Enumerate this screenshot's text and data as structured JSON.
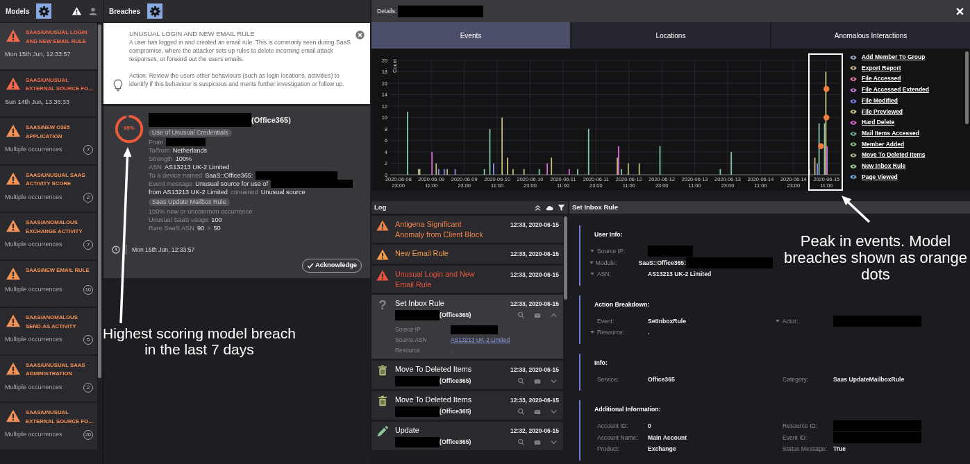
{
  "models_panel": {
    "title": "Models",
    "items": [
      {
        "title": "SAAS/UNUSUAL LOGIN AND NEW EMAIL RULE",
        "time": "Mon 15th Jun, 12:33:57",
        "color": "#f06a4a",
        "selected": true
      },
      {
        "title": "SAAS/UNUSUAL EXTERNAL SOURCE FO...",
        "time": "Sun 14th Jun, 13:36:33",
        "color": "#f06a4a",
        "selected": false
      },
      {
        "title": "SAAS/NEW O365 APPLICATION",
        "occurrences": "Multiple occurrences",
        "count": "7",
        "color": "#f59256",
        "selected": false
      },
      {
        "title": "SAAS/UNUSUAL SAAS ACTIVITY SCORE",
        "occurrences": "Multiple occurrences",
        "count": "2",
        "color": "#f59256",
        "selected": false
      },
      {
        "title": "SAAS/ANOMALOUS EXCHANGE ACTIVITY",
        "occurrences": "Multiple occurrences",
        "count": "7",
        "color": "#f59256",
        "selected": false
      },
      {
        "title": "SAAS/NEW EMAIL RULE",
        "occurrences": "Multiple occurrences",
        "count": "10",
        "color": "#f59256",
        "selected": false
      },
      {
        "title": "SAAS/ANOMALOUS SEND-AS ACTIVITY",
        "occurrences": "Multiple occurrences",
        "count": "5",
        "color": "#f59256",
        "selected": false
      },
      {
        "title": "SAAS/UNUSUAL SAAS ADMINISTRATION",
        "occurrences": "Multiple occurrences",
        "count": "2",
        "color": "#f59256",
        "selected": false
      },
      {
        "title": "SAAS/UNUSUAL EXTERNAL SOURCE FO...",
        "occurrences": "Multiple occurrences",
        "count": "20",
        "color": "#f59256",
        "selected": false
      }
    ]
  },
  "breaches_panel": {
    "title": "Breaches",
    "info": {
      "title": "UNUSUAL LOGIN AND NEW EMAIL RULE",
      "description": "A user has logged in and created an email rule. This is commonly seen during SaaS compromise, where the attacker sets up rules to delete incoming email attack responses, or forward out the users emails.",
      "action": "Action: Review the users other behaviours (such as login locations, activities) to identify if this behaviour is suspicious and merits further investigation or follow up."
    },
    "breach": {
      "score": "95%",
      "level": 0.95,
      "device_suffix": "(Office365)",
      "sections": [
        {
          "tag": "Use of Unusual Credentials",
          "lines": [
            [
              {
                "kind": "label",
                "text": "From"
              },
              {
                "kind": "redacted"
              }
            ],
            [
              {
                "kind": "label",
                "text": "To/from"
              },
              {
                "kind": "value",
                "text": "Netherlands"
              }
            ],
            [
              {
                "kind": "label",
                "text": "Strength"
              },
              {
                "kind": "value",
                "text": "100%"
              }
            ],
            [
              {
                "kind": "label",
                "text": "ASN"
              },
              {
                "kind": "value",
                "text": "AS13213 UK-2 Limited"
              }
            ],
            [
              {
                "kind": "label",
                "text": "To a device named"
              },
              {
                "kind": "value",
                "text": "SaaS::Office365:"
              },
              {
                "kind": "redacted"
              }
            ],
            [
              {
                "kind": "label",
                "text": "Event message"
              },
              {
                "kind": "value",
                "text": "Unusual source for use of"
              },
              {
                "kind": "redacted"
              }
            ],
            [
              {
                "kind": "value",
                "text": "from AS13213 UK-2 Limited"
              },
              {
                "kind": "label",
                "text": "contained"
              },
              {
                "kind": "value",
                "text": "Unusual source"
              }
            ]
          ]
        },
        {
          "tag": "Saas Update Mailbox Rule",
          "lines": [
            [
              {
                "kind": "label",
                "text": "100% new or uncommon occurrence"
              }
            ],
            [
              {
                "kind": "label",
                "text": "Unusual SaaS usage"
              },
              {
                "kind": "value",
                "text": "100"
              }
            ],
            [
              {
                "kind": "label",
                "text": "Rare SaaS ASN"
              },
              {
                "kind": "value",
                "text": "90"
              },
              {
                "kind": "label",
                "text": ">"
              },
              {
                "kind": "value",
                "text": "50"
              }
            ]
          ]
        }
      ],
      "time": "Mon 15th Jun, 12:33:57",
      "button": "Acknowledge"
    }
  },
  "details": {
    "title": "Details:",
    "tabs": [
      {
        "label": "Events",
        "selected": true
      },
      {
        "label": "Locations",
        "selected": false
      },
      {
        "label": "Anomalous Interactions",
        "selected": false
      }
    ],
    "chart_data": {
      "type": "bar",
      "ylabel": "Count",
      "ylim": [
        0,
        20
      ],
      "yticks": [
        0,
        2,
        4,
        6,
        8,
        10,
        12,
        14,
        16,
        18,
        20
      ],
      "categories": [
        null,
        "2020-06-08 23:00",
        null,
        null,
        null,
        null,
        null,
        "2020-06-09 11:00",
        null,
        null,
        null,
        null,
        null,
        "2020-06-09 23:00",
        null,
        null,
        null,
        null,
        null,
        "2020-06-10 11:00",
        null,
        null,
        null,
        null,
        null,
        "2020-06-10 23:00",
        null,
        null,
        null,
        null,
        null,
        "2020-06-11 11:00",
        null,
        null,
        null,
        null,
        null,
        "2020-06-11 23:00",
        null,
        null,
        null,
        null,
        null,
        "2020-06-12 11:00",
        null,
        null,
        null,
        null,
        null,
        "2020-06-12 23:00",
        null,
        null,
        null,
        null,
        null,
        "2020-06-13 11:00",
        null,
        null,
        null,
        null,
        null,
        "2020-06-13 23:00",
        null,
        null,
        null,
        null,
        null,
        "2020-06-14 11:00",
        null,
        null,
        null,
        null,
        null,
        "2020-06-14 23:00",
        null,
        null,
        null,
        null,
        null,
        "2020-06-15 11:00",
        null,
        null
      ],
      "series": [
        {
          "color": "#86c5a8",
          "values": [
            null,
            null,
            null,
            11,
            null,
            1,
            null,
            null,
            null,
            null,
            null,
            null,
            null,
            null,
            null,
            null,
            null,
            1,
            8,
            null,
            null,
            null,
            null,
            null,
            null,
            null,
            null,
            1,
            null,
            null,
            null,
            null,
            null,
            null,
            1,
            null,
            8,
            null,
            null,
            null,
            null,
            null,
            1,
            null,
            null,
            null,
            null,
            null,
            null,
            5,
            null,
            null,
            null,
            null,
            null,
            null,
            null,
            null,
            null,
            null,
            1,
            null,
            4,
            null,
            null,
            null,
            null,
            null,
            null,
            null,
            null,
            null,
            null,
            null,
            null,
            null,
            null,
            null,
            9,
            9,
            null,
            null
          ]
        },
        {
          "color": "#c4bd78",
          "values": [
            null,
            null,
            null,
            null,
            null,
            1,
            null,
            null,
            2,
            null,
            1,
            null,
            null,
            null,
            null,
            null,
            null,
            null,
            null,
            null,
            10,
            3,
            1,
            null,
            1,
            null,
            null,
            null,
            null,
            3,
            null,
            null,
            null,
            null,
            null,
            null,
            null,
            null,
            null,
            null,
            null,
            3,
            null,
            2,
            null,
            2,
            null,
            null,
            null,
            null,
            null,
            null,
            null,
            null,
            null,
            null,
            null,
            null,
            null,
            null,
            null,
            null,
            null,
            null,
            null,
            null,
            null,
            null,
            null,
            null,
            null,
            null,
            null,
            null,
            null,
            null,
            1,
            3,
            null,
            18,
            null,
            null
          ]
        },
        {
          "color": "#d46fd4",
          "values": [
            null,
            null,
            null,
            null,
            null,
            null,
            null,
            4,
            null,
            null,
            null,
            null,
            null,
            null,
            null,
            null,
            null,
            null,
            null,
            null,
            null,
            null,
            null,
            null,
            null,
            null,
            null,
            null,
            2,
            null,
            null,
            null,
            1,
            null,
            null,
            null,
            null,
            null,
            null,
            null,
            null,
            5,
            null,
            null,
            null,
            null,
            null,
            null,
            null,
            null,
            null,
            null,
            null,
            null,
            null,
            null,
            null,
            null,
            null,
            null,
            null,
            null,
            null,
            null,
            null,
            null,
            null,
            null,
            null,
            null,
            null,
            null,
            null,
            null,
            null,
            null,
            null,
            null,
            null,
            5,
            null,
            null
          ]
        },
        {
          "color": "#8a8ae6",
          "values": [
            null,
            null,
            null,
            null,
            null,
            null,
            null,
            null,
            1,
            1,
            null,
            1,
            null,
            null,
            null,
            null,
            null,
            null,
            2,
            null,
            null,
            null,
            null,
            null,
            null,
            null,
            null,
            null,
            null,
            null,
            null,
            null,
            null,
            null,
            null,
            null,
            null,
            null,
            null,
            null,
            null,
            null,
            null,
            null,
            null,
            null,
            null,
            null,
            null,
            null,
            null,
            null,
            null,
            null,
            null,
            null,
            null,
            null,
            null,
            null,
            null,
            null,
            null,
            null,
            null,
            null,
            null,
            null,
            null,
            null,
            null,
            null,
            null,
            null,
            null,
            null,
            null,
            2,
            null,
            null,
            null,
            null
          ]
        },
        {
          "type": "scatter",
          "color": "#f2803e",
          "values": [
            null,
            null,
            null,
            null,
            null,
            null,
            null,
            null,
            null,
            null,
            null,
            null,
            null,
            null,
            null,
            null,
            null,
            null,
            null,
            null,
            null,
            null,
            null,
            null,
            null,
            null,
            null,
            null,
            null,
            null,
            null,
            null,
            null,
            null,
            null,
            null,
            null,
            null,
            null,
            null,
            null,
            null,
            null,
            null,
            null,
            null,
            null,
            null,
            null,
            null,
            null,
            null,
            null,
            null,
            null,
            null,
            null,
            null,
            null,
            null,
            null,
            null,
            null,
            null,
            null,
            null,
            null,
            null,
            null,
            null,
            null,
            null,
            null,
            null,
            null,
            null,
            null,
            null,
            5,
            15,
            null,
            null
          ]
        },
        {
          "type": "scatter",
          "color": "#f2803e",
          "values": [
            null,
            null,
            null,
            null,
            null,
            null,
            null,
            null,
            null,
            null,
            null,
            null,
            null,
            null,
            null,
            null,
            null,
            null,
            null,
            null,
            null,
            null,
            null,
            null,
            null,
            null,
            null,
            null,
            null,
            null,
            null,
            null,
            null,
            null,
            null,
            null,
            null,
            null,
            null,
            null,
            null,
            null,
            null,
            null,
            null,
            null,
            null,
            null,
            null,
            null,
            null,
            null,
            null,
            null,
            null,
            null,
            null,
            null,
            null,
            null,
            null,
            null,
            null,
            null,
            null,
            null,
            null,
            null,
            null,
            null,
            null,
            null,
            null,
            null,
            null,
            null,
            null,
            null,
            null,
            10,
            null,
            null
          ]
        }
      ],
      "stacked": false,
      "grid": true
    },
    "legend": [
      {
        "label": "Add Member To Group",
        "color": "#9aa0c0"
      },
      {
        "label": "Export Report",
        "color": "#c8b880"
      },
      {
        "label": "File Accessed",
        "color": "#e07aa8"
      },
      {
        "label": "File Accessed Extended",
        "color": "#d070e0"
      },
      {
        "label": "File Modified",
        "color": "#7a7ae0"
      },
      {
        "label": "File Previewed",
        "color": "#c8c27a"
      },
      {
        "label": "Hard Delete",
        "color": "#e060d0"
      },
      {
        "label": "Mail Items Accessed",
        "color": "#70b090"
      },
      {
        "label": "Member Added",
        "color": "#80c080"
      },
      {
        "label": "Move To Deleted Items",
        "color": "#b0b080"
      },
      {
        "label": "New Inbox Rule",
        "color": "#90d090"
      },
      {
        "label": "Page Viewed",
        "color": "#70b0e0"
      }
    ]
  },
  "log": {
    "title": "Log",
    "items": [
      {
        "kind": "alert",
        "title": "Antigena Significant Anomaly from Client Block",
        "time": "12:33, 2020-06-15",
        "color": "#f0834a"
      },
      {
        "kind": "alert",
        "title": "New Email Rule",
        "time": "12:33, 2020-06-15",
        "color": "#f59a4a"
      },
      {
        "kind": "alert",
        "title": "Unusual Login and New Email Rule",
        "time": "12:33, 2020-06-15",
        "color": "#e8553f"
      },
      {
        "kind": "question",
        "icon_char": "?",
        "title": "Set Inbox Rule",
        "time": "12:33, 2020-06-15",
        "device_suffix": "(Office365)",
        "expanded": true,
        "details": [
          {
            "label": "Source IP",
            "redacted": true
          },
          {
            "label": "Source ASN",
            "value": "AS13213 UK-2 Limited",
            "link": true
          },
          {
            "label": "Resource",
            "value": "."
          }
        ]
      },
      {
        "kind": "trash",
        "title": "Move To Deleted Items",
        "time": "12:33, 2020-06-15",
        "device_suffix": "(Office365)",
        "expanded": false
      },
      {
        "kind": "trash",
        "title": "Move To Deleted Items",
        "time": "12:33, 2020-06-15",
        "device_suffix": "(Office365)",
        "expanded": false
      },
      {
        "kind": "edit",
        "title": "Update",
        "time": "12:32, 2020-06-15",
        "device_suffix": "(Office365)",
        "expanded": false
      }
    ]
  },
  "event": {
    "title": "Set Inbox Rule",
    "sections": [
      {
        "title": "User Info:",
        "rows": [
          {
            "left": {
              "label": "Source IP:",
              "caret": true,
              "redacted": true
            }
          },
          {
            "left": {
              "label": "Module:",
              "caret": true,
              "value": "SaaS::Office365:",
              "redacted": true
            }
          },
          {
            "left": {
              "label": "ASN:",
              "caret": true,
              "value": "AS13213 UK-2 Limited"
            }
          }
        ]
      },
      {
        "title": "Action Breakdown:",
        "rows": [
          {
            "left": {
              "label": "Event:",
              "value": "SetInboxRule"
            },
            "right": {
              "label": "Actor:",
              "caret": true,
              "redacted": true
            }
          },
          {
            "left": {
              "label": "Resource:",
              "caret": true,
              "value": "."
            }
          }
        ]
      },
      {
        "title": "Info:",
        "rows": [
          {
            "left": {
              "label": "Service:",
              "value": "Office365"
            },
            "right": {
              "label": "Category:",
              "value": "Saas UpdateMailboxRule"
            }
          }
        ]
      },
      {
        "title": "Additional Information:",
        "rows": [
          {
            "left": {
              "label": "Account ID:",
              "value": "0"
            },
            "right": {
              "label": "Resource ID:",
              "redacted": true
            }
          },
          {
            "left": {
              "label": "Account Name:",
              "value": "Main Account"
            },
            "right": {
              "label": "Event ID:",
              "redacted": true
            }
          },
          {
            "left": {
              "label": "Product:",
              "value": "Exchange"
            },
            "right": {
              "label": "Status Message:",
              "value": "True"
            }
          }
        ]
      }
    ]
  },
  "annotations": [
    {
      "text": "Highest scoring model breach in the last 7 days"
    },
    {
      "text": "Peak in events. Model breaches shown as orange dots"
    }
  ]
}
